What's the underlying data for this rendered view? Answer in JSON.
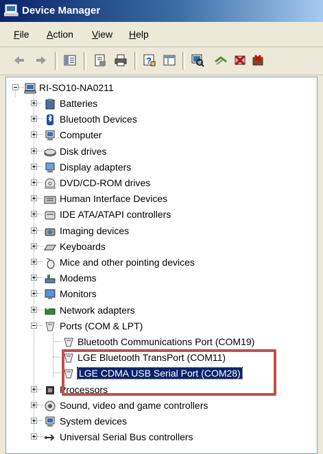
{
  "window": {
    "title": "Device Manager"
  },
  "menu": [
    {
      "label": "File",
      "accel": "F",
      "rest": "ile"
    },
    {
      "label": "Action",
      "accel": "A",
      "rest": "ction"
    },
    {
      "label": "View",
      "accel": "V",
      "rest": "iew"
    },
    {
      "label": "Help",
      "accel": "H",
      "rest": "elp"
    }
  ],
  "toolbar": {
    "buttons": [
      "back-icon",
      "forward-icon",
      "show-hide-tree-icon",
      "properties-icon",
      "print-icon",
      "help-icon",
      "details-view-icon",
      "scan-hardware-icon",
      "update-driver-icon",
      "disable-device-icon",
      "uninstall-device-icon"
    ]
  },
  "tree": {
    "root": "RI-SO10-NA0211",
    "categories": [
      {
        "label": "Batteries",
        "icon": "battery-icon"
      },
      {
        "label": "Bluetooth Devices",
        "icon": "bluetooth-icon"
      },
      {
        "label": "Computer",
        "icon": "computer-icon"
      },
      {
        "label": "Disk drives",
        "icon": "disk-drive-icon"
      },
      {
        "label": "Display adapters",
        "icon": "display-adapter-icon"
      },
      {
        "label": "DVD/CD-ROM drives",
        "icon": "dvd-drive-icon"
      },
      {
        "label": "Human Interface Devices",
        "icon": "hid-icon"
      },
      {
        "label": "IDE ATA/ATAPI controllers",
        "icon": "ide-controller-icon"
      },
      {
        "label": "Imaging devices",
        "icon": "camera-icon"
      },
      {
        "label": "Keyboards",
        "icon": "keyboard-icon"
      },
      {
        "label": "Mice and other pointing devices",
        "icon": "mouse-icon"
      },
      {
        "label": "Modems",
        "icon": "modem-icon"
      },
      {
        "label": "Monitors",
        "icon": "monitor-icon"
      },
      {
        "label": "Network adapters",
        "icon": "network-adapter-icon"
      },
      {
        "label": "Ports (COM & LPT)",
        "icon": "port-icon",
        "expanded": true,
        "children": [
          {
            "label": "Bluetooth Communications Port (COM19)",
            "icon": "port-icon"
          },
          {
            "label": "LGE Bluetooth TransPort (COM11)",
            "icon": "port-icon"
          },
          {
            "label": "LGE CDMA USB Serial Port (COM28)",
            "icon": "port-icon",
            "selected": true
          }
        ]
      },
      {
        "label": "Processors",
        "icon": "processor-icon"
      },
      {
        "label": "Sound, video and game controllers",
        "icon": "sound-icon"
      },
      {
        "label": "System devices",
        "icon": "system-devices-icon"
      },
      {
        "label": "Universal Serial Bus controllers",
        "icon": "usb-icon"
      }
    ]
  },
  "colors": {
    "highlight_box": "#c0504d",
    "selection": "#0a246a",
    "title_bar": "#0a246a"
  }
}
